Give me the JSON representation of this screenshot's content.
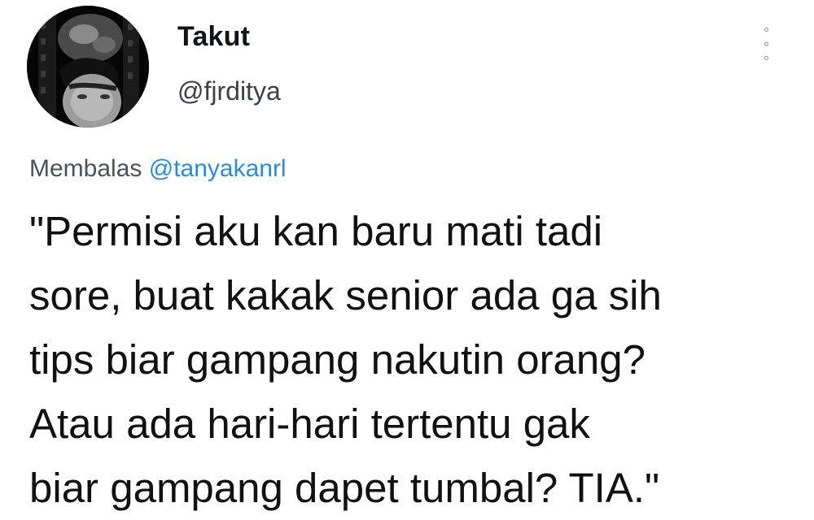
{
  "tweet": {
    "display_name": "Takut",
    "handle": "@fjrditya",
    "more_icon": "vertical-ellipsis-icon",
    "reply_prefix": "Membalas",
    "reply_mention": "@tanyakanrl",
    "text_lines": [
      "\"Permisi aku kan baru mati tadi",
      "sore, buat kakak senior ada ga sih",
      "tips biar gampang nakutin orang?",
      "Atau ada hari-hari tertentu gak",
      "biar gampang dapet tumbal? TIA.\""
    ]
  },
  "colors": {
    "mention": "#2f8ad8",
    "text": "#111111",
    "secondary": "#4b5258"
  }
}
